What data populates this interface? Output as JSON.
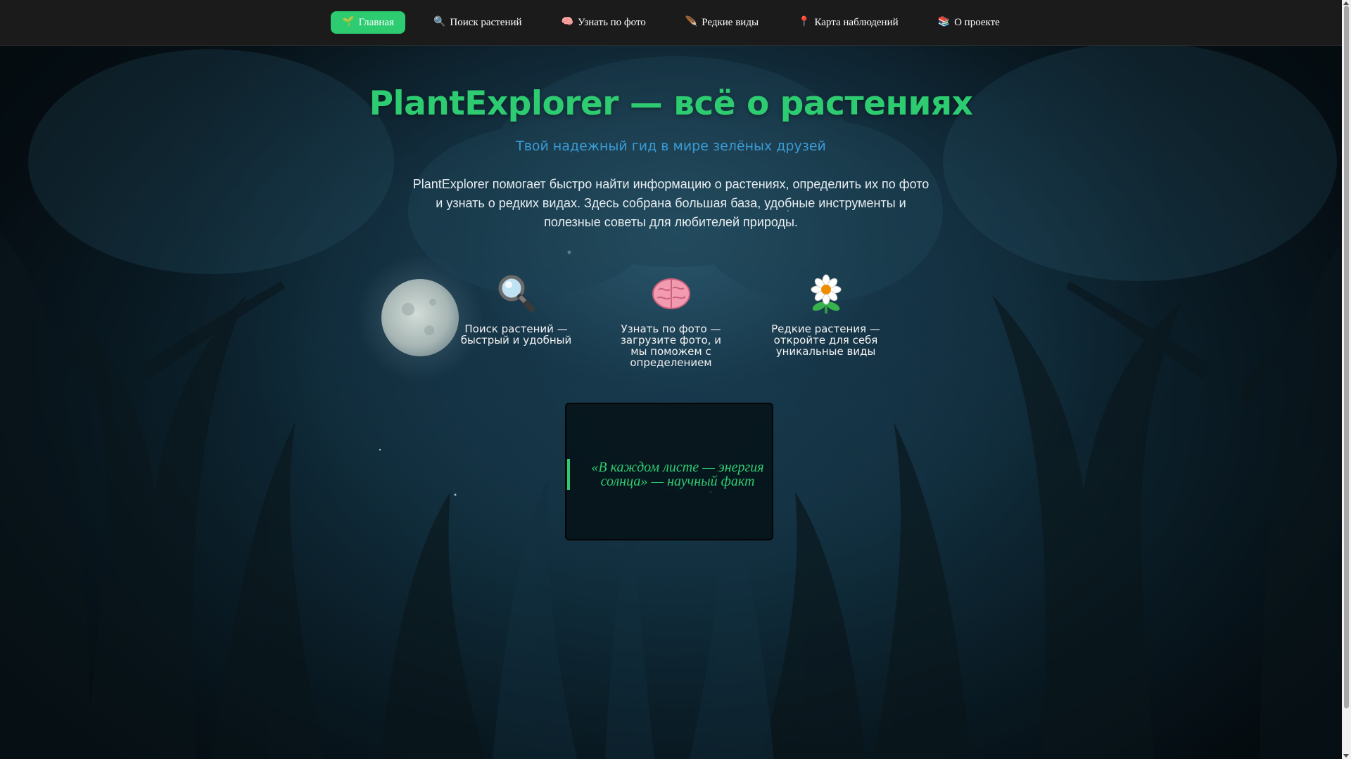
{
  "nav": {
    "items": [
      {
        "icon": "🌱",
        "icon_name": "sprout-icon",
        "label": "Главная",
        "active": true
      },
      {
        "icon": "🔍",
        "icon_name": "search-icon",
        "label": "Поиск растений",
        "active": false
      },
      {
        "icon": "🧠",
        "icon_name": "brain-icon",
        "label": "Узнать по фото",
        "active": false
      },
      {
        "icon": "🪶",
        "icon_name": "feather-icon",
        "label": "Редкие виды",
        "active": false
      },
      {
        "icon": "📍",
        "icon_name": "pin-icon",
        "label": "Карта наблюдений",
        "active": false
      },
      {
        "icon": "📚",
        "icon_name": "books-icon",
        "label": "О проекте",
        "active": false
      }
    ]
  },
  "hero": {
    "title": "PlantExplorer — всё о растениях",
    "subtitle": "Твой надежный гид в мире зелёных друзей",
    "description": "PlantExplorer помогает быстро найти информацию о растениях, определить их по фото и узнать о редких видах. Здесь собрана большая база, удобные инструменты и полезные советы для любителей природы."
  },
  "features": [
    {
      "icon_name": "magnifier-icon",
      "text": "Поиск растений — быстрый и удобный"
    },
    {
      "icon_name": "brain-icon",
      "text": "Узнать по фото — загрузите фото, и мы поможем с определением"
    },
    {
      "icon_name": "flower-icon",
      "text": "Редкие растения — откройте для себя уникальные виды"
    }
  ],
  "quote": {
    "text": "«В каждом листе — энергия солнца» — научный факт"
  },
  "colors": {
    "accent": "#2ecc71",
    "subtitle": "#3b9bd6",
    "navbar": "#1b1b1b"
  }
}
